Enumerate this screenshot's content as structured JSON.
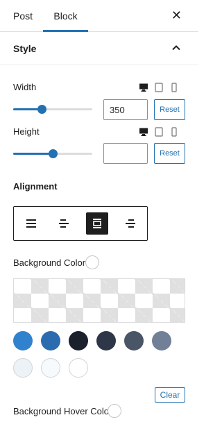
{
  "tabs": {
    "post": "Post",
    "block": "Block"
  },
  "section": {
    "title": "Style"
  },
  "width": {
    "label": "Width",
    "value": "350",
    "slider_percent": 36,
    "reset": "Reset"
  },
  "height": {
    "label": "Height",
    "value": "",
    "slider_percent": 50,
    "reset": "Reset"
  },
  "alignment": {
    "label": "Alignment",
    "options": [
      "align-left",
      "align-center-left",
      "align-center",
      "align-right"
    ],
    "active": "align-center"
  },
  "background": {
    "label": "Background Color",
    "swatches": [
      "#3182ce",
      "#2b6cb0",
      "#1a202c",
      "#2d3748",
      "#4a5568",
      "#718096",
      "#edf2f7",
      "#f7fafc",
      "#ffffff"
    ],
    "clear": "Clear"
  },
  "hover": {
    "label": "Background Hover Color"
  },
  "colors": {
    "accent": "#2271b1",
    "text": "#1e1e1e"
  }
}
